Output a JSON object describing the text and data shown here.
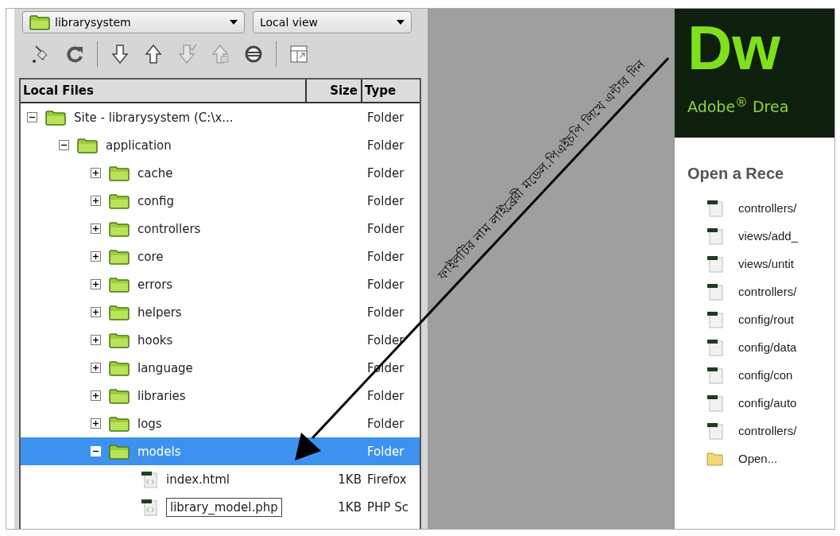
{
  "files_panel": {
    "site_select": {
      "value": "librarysystem"
    },
    "view_select": {
      "value": "Local view"
    },
    "toolbar": [
      {
        "kind": "connect",
        "disabled": false
      },
      {
        "kind": "refresh",
        "disabled": false
      },
      {
        "kind": "get",
        "disabled": false
      },
      {
        "kind": "put",
        "disabled": false
      },
      {
        "kind": "check-out",
        "disabled": true
      },
      {
        "kind": "check-in",
        "disabled": true
      },
      {
        "kind": "sync",
        "disabled": false
      },
      {
        "kind": "expand",
        "disabled": false
      }
    ],
    "columns": [
      "Local Files",
      "Size",
      "Type"
    ],
    "tree": [
      {
        "kind": "folder",
        "name": "Site - librarysystem (C:\\x...",
        "type": "Folder",
        "expanded": true,
        "selected": false,
        "children": [
          {
            "kind": "folder",
            "name": "application",
            "type": "Folder",
            "expanded": true,
            "selected": false,
            "children": [
              {
                "kind": "folder",
                "name": "cache",
                "type": "Folder",
                "expanded": false,
                "selected": false
              },
              {
                "kind": "folder",
                "name": "config",
                "type": "Folder",
                "expanded": false,
                "selected": false
              },
              {
                "kind": "folder",
                "name": "controllers",
                "type": "Folder",
                "expanded": false,
                "selected": false
              },
              {
                "kind": "folder",
                "name": "core",
                "type": "Folder",
                "expanded": false,
                "selected": false
              },
              {
                "kind": "folder",
                "name": "errors",
                "type": "Folder",
                "expanded": false,
                "selected": false
              },
              {
                "kind": "folder",
                "name": "helpers",
                "type": "Folder",
                "expanded": false,
                "selected": false
              },
              {
                "kind": "folder",
                "name": "hooks",
                "type": "Folder",
                "expanded": false,
                "selected": false
              },
              {
                "kind": "folder",
                "name": "language",
                "type": "Folder",
                "expanded": false,
                "selected": false
              },
              {
                "kind": "folder",
                "name": "libraries",
                "type": "Folder",
                "expanded": false,
                "selected": false
              },
              {
                "kind": "folder",
                "name": "logs",
                "type": "Folder",
                "expanded": false,
                "selected": false
              },
              {
                "kind": "folder",
                "name": "models",
                "type": "Folder",
                "expanded": true,
                "selected": true,
                "children": [
                  {
                    "kind": "file",
                    "name": "index.html",
                    "size": "1KB",
                    "type": "Firefox",
                    "selected": false,
                    "editing": false
                  },
                  {
                    "kind": "file",
                    "name": "library_model.php",
                    "size": "1KB",
                    "type": "PHP Sc",
                    "selected": false,
                    "editing": true
                  }
                ]
              }
            ]
          }
        ]
      }
    ]
  },
  "welcome": {
    "logo": "Dw",
    "product": "Adobe$^{®}$ Drea",
    "recent_title": "Open a Rece",
    "recent": [
      {
        "kind": "document",
        "label": "controllers/"
      },
      {
        "kind": "document",
        "label": "views/add_"
      },
      {
        "kind": "document",
        "label": "views/untit"
      },
      {
        "kind": "document",
        "label": "controllers/"
      },
      {
        "kind": "document",
        "label": "config/rout"
      },
      {
        "kind": "document",
        "label": "config/data"
      },
      {
        "kind": "document",
        "label": "config/con"
      },
      {
        "kind": "document",
        "label": "config/auto"
      },
      {
        "kind": "document",
        "label": "controllers/"
      },
      {
        "kind": "open",
        "label": "Open..."
      }
    ]
  },
  "annotation": {
    "text": "ফাইলটির নাম লাইব্রেরী মডেল.পিএইচপি লিখে এন্টার দিন"
  }
}
